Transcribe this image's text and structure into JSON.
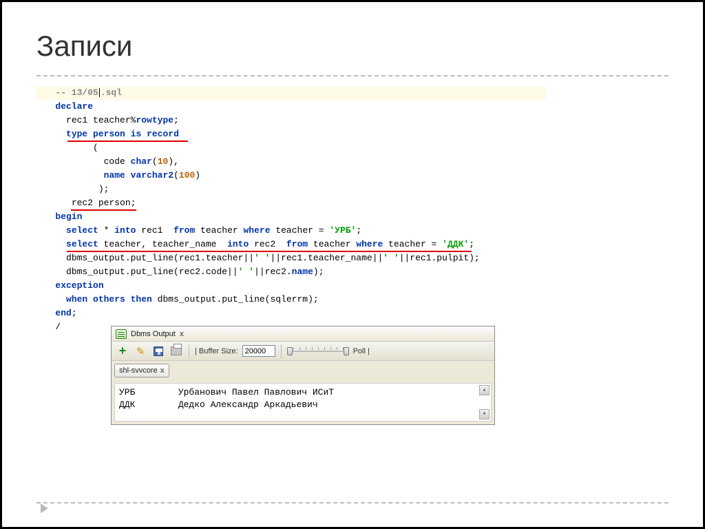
{
  "title": "Записи",
  "code": {
    "l1_comment": "-- 13/05",
    "l1_ext": ".sql",
    "l2": "declare",
    "l3_a": "rec1 teacher%",
    "l3_b": "rowtype",
    "l4_a": "type",
    "l4_b": "person",
    "l4_c": "is record",
    "l5": "(",
    "l6_a": "code",
    "l6_b": "char",
    "l6_c": "10",
    "l7_a": "name",
    "l7_b": "varchar2",
    "l7_c": "100",
    "l8": ");",
    "l9": "rec2 person;",
    "l10": "begin",
    "l11_a": "select",
    "l11_b": " * ",
    "l11_c": "into",
    "l11_d": " rec1  ",
    "l11_e": "from",
    "l11_f": " teacher ",
    "l11_g": "where",
    "l11_h": " teacher = ",
    "l11_i": "'УРБ'",
    "l12_a": "select",
    "l12_b": " teacher, teacher_name  ",
    "l12_c": "into",
    "l12_d": " rec2  ",
    "l12_e": "from",
    "l12_f": " teacher ",
    "l12_g": "where",
    "l12_h": " teacher = ",
    "l12_i": "'ДДК'",
    "l13_a": "dbms_output.put_line(rec1.teacher||",
    "l13_b": "' '",
    "l13_c": "||rec1.teacher_name||",
    "l13_d": "' '",
    "l13_e": "||rec1.pulpit);",
    "l14_a": "dbms_output.put_line(rec2.code||",
    "l14_b": "' '",
    "l14_c": "||rec2.",
    "l14_d": "name",
    "l14_e": ");",
    "l15": "exception",
    "l16_a": "when others then",
    "l16_b": " dbms_output.put_line(sqlerrm);",
    "l17": "end",
    "l18": "/"
  },
  "dbms": {
    "title": "Dbms Output",
    "close": "x",
    "buffer_label": "| Buffer Size:",
    "buffer_value": "20000",
    "poll_label": "Poll |",
    "conn_tab": "shl-svvcore",
    "conn_close": "x",
    "out_row1": "УРБ        Урбанович Павел Павлович ИСиТ",
    "out_row2": "ДДК        Дедко Александр Аркадьевич"
  }
}
